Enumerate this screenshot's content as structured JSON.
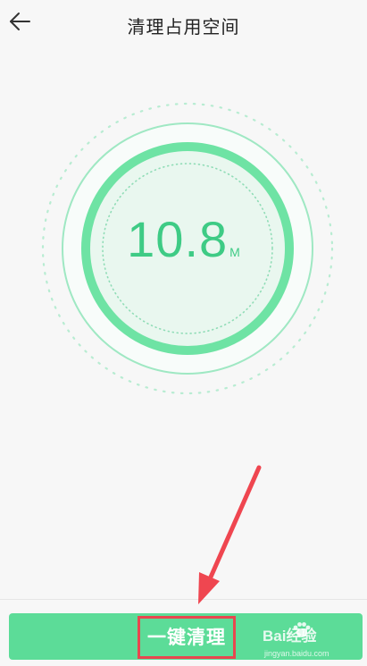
{
  "header": {
    "title": "清理占用空间",
    "back_icon": "arrow-left-icon"
  },
  "gauge": {
    "value": "10.8",
    "unit": "M",
    "accent_color": "#3ecb85",
    "ring_color": "#6ee3a4",
    "fill_color": "#e9f7ef"
  },
  "action": {
    "clean_label": "一键清理",
    "button_color": "#5cdc98",
    "highlight_color": "#e8474f"
  },
  "watermark": {
    "brand": "Bai经验",
    "url": "jingyan.baidu.com",
    "paw_icon": "paw-icon"
  },
  "annotation": {
    "arrow_icon": "pointer-arrow-icon",
    "arrow_color": "#ef4650"
  }
}
